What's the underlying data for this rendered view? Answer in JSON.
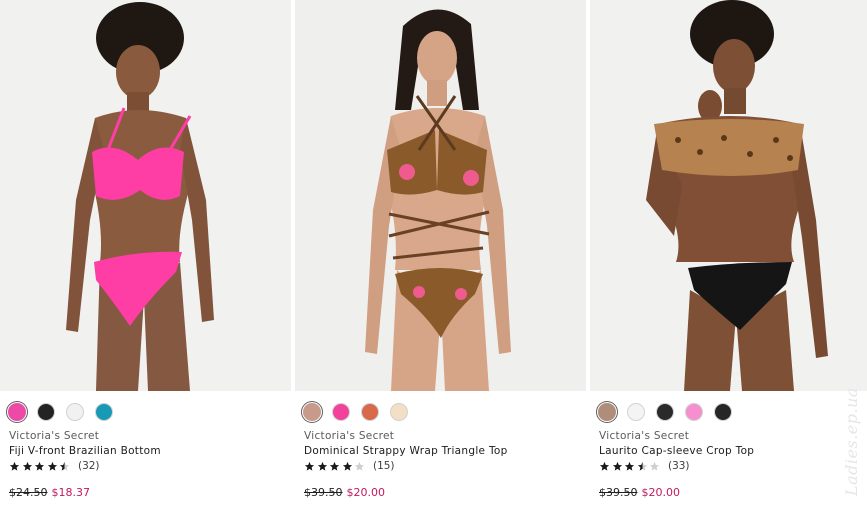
{
  "products": [
    {
      "image": "model wearing pink push-up bikini top and pink brazilian bottom",
      "swatches": [
        {
          "name": "pink",
          "color": "#ec4aa6",
          "selected": true
        },
        {
          "name": "black",
          "color": "#232323",
          "selected": false
        },
        {
          "name": "white",
          "color": "#f1f1f1",
          "selected": false
        },
        {
          "name": "teal",
          "color": "#1899b6",
          "selected": false
        }
      ],
      "brand": "Victoria's Secret",
      "name": "Fiji V-front Brazilian Bottom",
      "rating": 4.5,
      "review_count": "(32)",
      "price_was": "$24.50",
      "price_now": "$18.37"
    },
    {
      "image": "model wearing leopard floral strappy wrap triangle bikini",
      "swatches": [
        {
          "name": "leopard-floral",
          "color": "#c79a8a",
          "selected": true
        },
        {
          "name": "pink",
          "color": "#f2429a",
          "selected": false
        },
        {
          "name": "rust",
          "color": "#d8694a",
          "selected": false
        },
        {
          "name": "floral-light",
          "color": "#f2dfc6",
          "selected": false
        }
      ],
      "brand": "Victoria's Secret",
      "name": "Dominical Strappy Wrap Triangle Top",
      "rating": 4,
      "review_count": "(15)",
      "price_was": "$39.50",
      "price_now": "$20.00"
    },
    {
      "image": "model wearing leopard cap-sleeve crop top and black bottom",
      "swatches": [
        {
          "name": "leopard",
          "color": "#b08c7a",
          "selected": true
        },
        {
          "name": "white",
          "color": "#f4f4f4",
          "selected": false
        },
        {
          "name": "black-dot",
          "color": "#2a2a2a",
          "selected": false
        },
        {
          "name": "pink",
          "color": "#f58fd0",
          "selected": false
        },
        {
          "name": "black",
          "color": "#262626",
          "selected": false
        }
      ],
      "brand": "Victoria's Secret",
      "name": "Laurito Cap-sleeve Crop Top",
      "rating": 3.5,
      "review_count": "(33)",
      "price_was": "$39.50",
      "price_now": "$20.00"
    }
  ],
  "watermark": "Ladies.ep.ua"
}
